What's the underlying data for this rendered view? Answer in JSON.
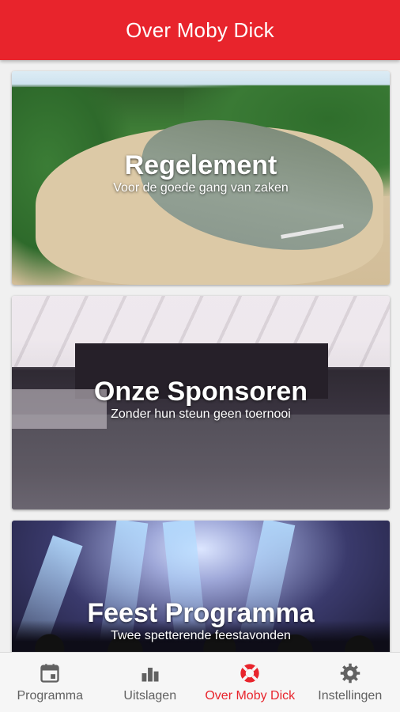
{
  "app_bar": {
    "title": "Over Moby Dick"
  },
  "cards": [
    {
      "title": "Regelement",
      "subtitle": "Voor de goede gang van zaken"
    },
    {
      "title": "Onze Sponsoren",
      "subtitle": "Zonder hun steun geen toernooi"
    },
    {
      "title": "Feest Programma",
      "subtitle": "Twee spetterende feestavonden"
    }
  ],
  "bottom_nav": {
    "items": [
      {
        "label": "Programma",
        "icon": "calendar-icon",
        "active": false
      },
      {
        "label": "Uitslagen",
        "icon": "bar-chart-icon",
        "active": false
      },
      {
        "label": "Over Moby Dick",
        "icon": "lifebuoy-icon",
        "active": true
      },
      {
        "label": "Instellingen",
        "icon": "gear-icon",
        "active": false
      }
    ]
  },
  "colors": {
    "primary": "#e8242c",
    "nav_inactive": "#616161",
    "nav_background": "#f6f6f6"
  }
}
